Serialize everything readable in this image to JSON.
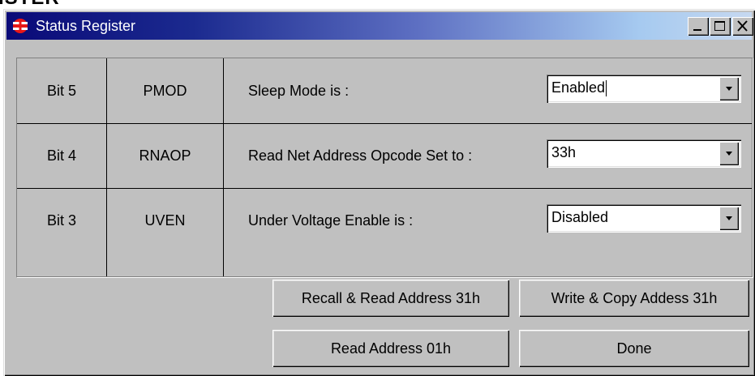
{
  "background": {
    "title_fragment": "ISTER"
  },
  "window": {
    "title": "Status Register",
    "buttons": {
      "minimize": "minimize",
      "maximize": "maximize",
      "close": "close"
    }
  },
  "rows": [
    {
      "bit": "Bit 5",
      "name": "PMOD",
      "label": "Sleep Mode is :",
      "value": "Enabled"
    },
    {
      "bit": "Bit 4",
      "name": "RNAOP",
      "label": "Read Net Address Opcode Set to :",
      "value": "33h"
    },
    {
      "bit": "Bit 3",
      "name": "UVEN",
      "label": "Under Voltage Enable is :",
      "value": "Disabled"
    }
  ],
  "actions": {
    "recall_read": "Recall & Read Address 31h",
    "write_copy": "Write & Copy Addess 31h",
    "read_address": "Read Address 01h",
    "done": "Done"
  },
  "colors": {
    "titlebar_start": "#0a0a78",
    "titlebar_end": "#c6d8f0",
    "face": "#c0c0c0",
    "icon_red": "#e81818"
  },
  "icons": {
    "app": "chip-icon",
    "combo_arrow": "chevron-down-icon"
  }
}
